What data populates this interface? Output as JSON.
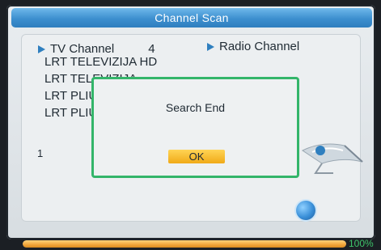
{
  "title": "Channel Scan",
  "tv": {
    "header_label": "TV Channel",
    "count": "4",
    "channels": [
      "LRT TELEVIZIJA HD",
      "LRT TELEVIZIJA",
      "LRT PLIUS",
      "LRT PLIUS HD"
    ]
  },
  "radio": {
    "header_label": "Radio Channel"
  },
  "bottom_number": "1",
  "dialog": {
    "message": "Search End",
    "ok_label": "OK"
  },
  "progress": {
    "percent": 100,
    "label": "100%"
  },
  "colors": {
    "title_bar": "#3d8fcf",
    "dialog_border": "#33b56a",
    "ok_button": "#f5b52a",
    "progress_fill": "#f1a53a",
    "progress_label": "#3ec46a"
  }
}
